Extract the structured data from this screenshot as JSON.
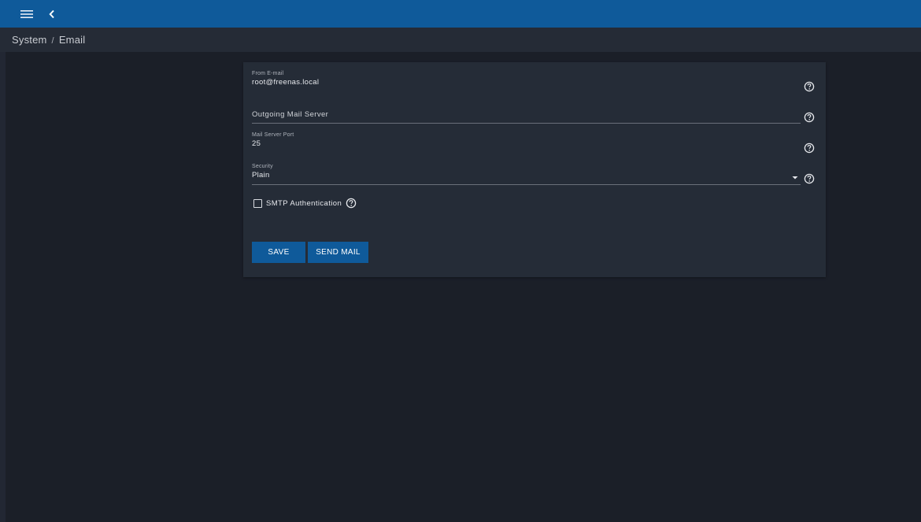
{
  "topbar": {
    "menu_icon": "menu-icon",
    "back_icon": "chevron-left-icon",
    "color": "#0f5a9a"
  },
  "breadcrumb": {
    "section": "System",
    "separator": "/",
    "page": "Email"
  },
  "form": {
    "from_email": {
      "label": "From E-mail",
      "value": "root@freenas.local"
    },
    "outgoing_mail_server": {
      "placeholder": "Outgoing Mail Server",
      "value": ""
    },
    "mail_server_port": {
      "label": "Mail Server Port",
      "value": "25"
    },
    "security": {
      "label": "Security",
      "value": "Plain"
    },
    "smtp_authentication": {
      "label": "SMTP Authentication",
      "checked": false
    },
    "help_icon": "help-circle-icon"
  },
  "actions": {
    "save_label": "SAVE",
    "send_mail_label": "SEND MAIL"
  }
}
